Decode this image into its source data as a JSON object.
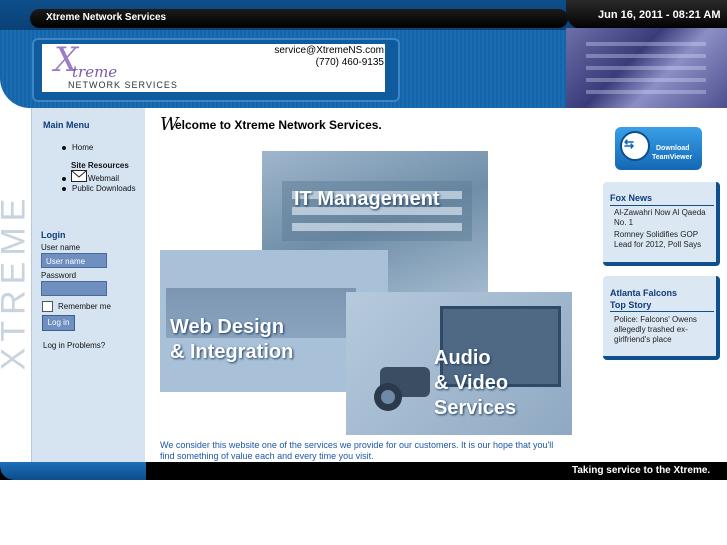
{
  "header": {
    "site_title": "Xtreme Network Services",
    "datetime": "Jun 16, 2011 - 08:21 AM",
    "logo": {
      "x": "X",
      "treme": "treme",
      "sub": "NETWORK SERVICES"
    },
    "contact_email": "service@XtremeNS.com",
    "contact_phone": "(770) 460-9135"
  },
  "vertical_brand": "XTREME",
  "sidebar": {
    "main_menu_heading": "Main Menu",
    "home": "Home",
    "site_resources": "Site Resources",
    "webmail": "Webmail",
    "public_downloads": "Public Downloads",
    "login_heading": "Login",
    "username_label": "User name",
    "username_placeholder": "User name",
    "password_label": "Password",
    "remember_me": "Remember me",
    "login_button": "Log in",
    "login_problems": "Log in Problems?"
  },
  "main": {
    "welcome_initial": "W",
    "welcome_rest": "elcome to Xtreme Network Services.",
    "collage": {
      "it": "IT Management",
      "web_line1": "Web Design",
      "web_line2": "& Integration",
      "av_line1": "Audio",
      "av_line2": "& Video",
      "av_line3": "Services"
    },
    "body_text": "We consider this website one of the services we provide for our customers. It is our hope that you'll find something of value each and every time you visit."
  },
  "right": {
    "teamviewer_line1": "Download",
    "teamviewer_line2": "TeamViewer",
    "fox": {
      "heading": "Fox News",
      "items": [
        "Al-Zawahri Now Al Qaeda No. 1",
        "Romney Solidifies GOP Lead for 2012, Poll Says"
      ]
    },
    "falcons": {
      "heading_line1": "Atlanta Falcons",
      "heading_line2": "Top Story",
      "items": [
        "Police: Falcons' Owens allegedly trashed ex-girlfriend's place"
      ]
    }
  },
  "footer": {
    "tagline": "Taking service to the Xtreme."
  }
}
